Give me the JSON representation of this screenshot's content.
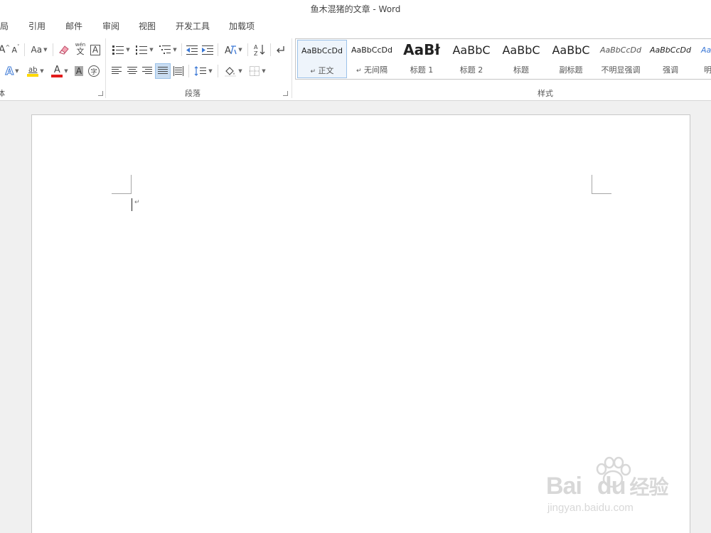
{
  "window": {
    "title": "鱼木混猪的文章 - Word"
  },
  "tabs": [
    "局",
    "引用",
    "邮件",
    "审阅",
    "视图",
    "开发工具",
    "加载项"
  ],
  "font_group": {
    "grow_font_glyph": "A",
    "shrink_font_glyph": "A",
    "change_case_label": "Aa",
    "phonetic_guide_top": "wén",
    "phonetic_guide_main": "文",
    "char_border_glyph": "A",
    "text_effects_glyph": "A",
    "highlight_label": "ab",
    "font_color_glyph": "A",
    "char_shading_glyph": "A",
    "enclose_char_glyph": "字",
    "label": "体",
    "highlight_color": "#ffd800",
    "font_color": "#e21b1b"
  },
  "paragraph_group": {
    "label": "段落"
  },
  "styles_group": {
    "label": "样式",
    "items": [
      {
        "preview": "AaBbCcDd",
        "name": "正文",
        "mark": "↵"
      },
      {
        "preview": "AaBbCcDd",
        "name": "无间隔",
        "mark": "↵"
      },
      {
        "preview": "AaBł",
        "name": "标题 1",
        "mark": ""
      },
      {
        "preview": "AaBbC",
        "name": "标题 2",
        "mark": ""
      },
      {
        "preview": "AaBbC",
        "name": "标题",
        "mark": ""
      },
      {
        "preview": "AaBbC",
        "name": "副标题",
        "mark": ""
      },
      {
        "preview": "AaBbCcDd",
        "name": "不明显强调",
        "mark": ""
      },
      {
        "preview": "AaBbCcDd",
        "name": "强调",
        "mark": ""
      },
      {
        "preview": "Aa",
        "name": "明",
        "mark": ""
      }
    ]
  },
  "document": {
    "paragraph_mark": "↵"
  },
  "watermark": {
    "logo_left": "Bai",
    "logo_mid": "du",
    "logo_right": "经验",
    "url": "jingyan.baidu.com"
  }
}
